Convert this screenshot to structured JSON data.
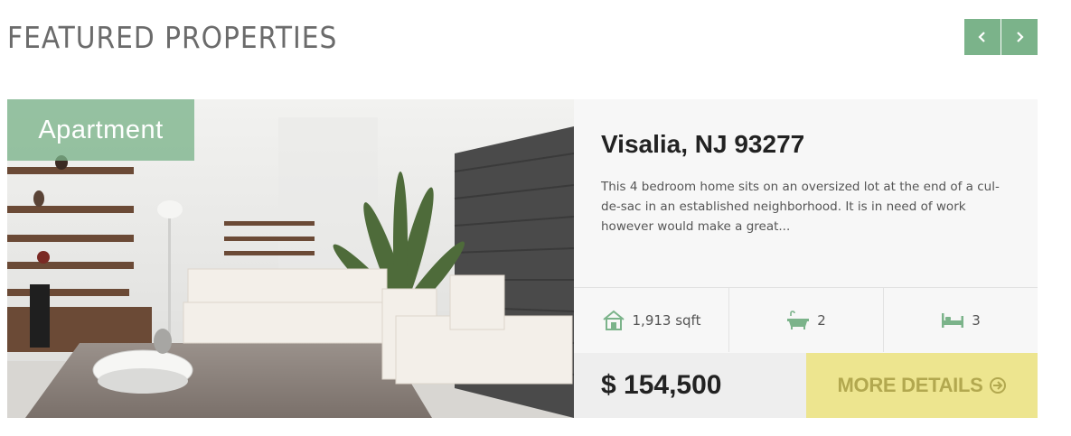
{
  "section": {
    "title": "FEATURED PROPERTIES",
    "prev_icon": "chevron-left-icon",
    "next_icon": "chevron-right-icon"
  },
  "property": {
    "type": "Apartment",
    "title": "Visalia, NJ 93277",
    "description": "This 4 bedroom home sits on an oversized lot at the end of a cul-de-sac in an established neighborhood. It is in need of work however would make a great...",
    "stats": {
      "area": "1,913 sqft",
      "baths": "2",
      "beds": "3"
    },
    "price": "$ 154,500",
    "more_label": "MORE DETAILS"
  },
  "colors": {
    "accent_green": "#7bb38a",
    "more_button": "#ede58f",
    "more_text": "#b2a84f"
  }
}
